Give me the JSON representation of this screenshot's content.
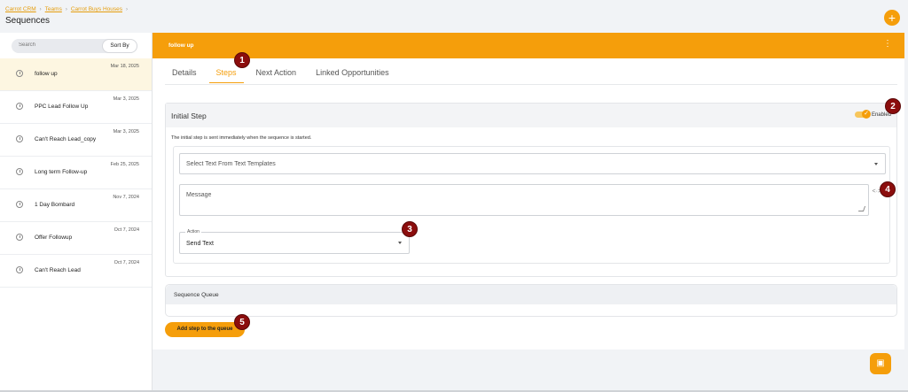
{
  "breadcrumb": [
    "Carrot CRM",
    "Teams",
    "Carrot Buys Houses"
  ],
  "page_title": "Sequences",
  "search": {
    "placeholder": "Search"
  },
  "sort_label": "Sort By",
  "sequences": [
    {
      "name": "follow up",
      "date": "Mar 18, 2025"
    },
    {
      "name": "PPC Lead Follow Up",
      "date": "Mar 3, 2025"
    },
    {
      "name": "Can't Reach Lead_copy",
      "date": "Mar 3, 2025"
    },
    {
      "name": "Long term Follow-up",
      "date": "Feb 25, 2025"
    },
    {
      "name": "1 Day Bombard",
      "date": "Nov 7, 2024"
    },
    {
      "name": "Offer Followup",
      "date": "Oct 7, 2024"
    },
    {
      "name": "Can't Reach Lead",
      "date": "Oct 7, 2024"
    }
  ],
  "main": {
    "title": "follow up",
    "tabs": [
      "Details",
      "Steps",
      "Next Action",
      "Linked Opportunities"
    ],
    "active_tab": "Steps"
  },
  "initial_step": {
    "title": "Initial Step",
    "enabled_label": "Enabled",
    "description": "The initial step is sent immediately when the sequence is started.",
    "template_placeholder": "Select Text From Text Templates",
    "message_placeholder": "Message",
    "action_label": "Action",
    "action_value": "Send Text"
  },
  "queue": {
    "title": "Sequence Queue"
  },
  "add_step_label": "Add step to the queue",
  "badges": [
    "1",
    "2",
    "3",
    "4",
    "5"
  ],
  "colors": {
    "accent": "#f59e0b",
    "badge": "#8b0d0d"
  },
  "icons": {
    "add": "plus-icon",
    "save": "floppy-disk-icon",
    "menu": "kebab-icon",
    "item": "clock-icon",
    "code": "code-icon"
  }
}
